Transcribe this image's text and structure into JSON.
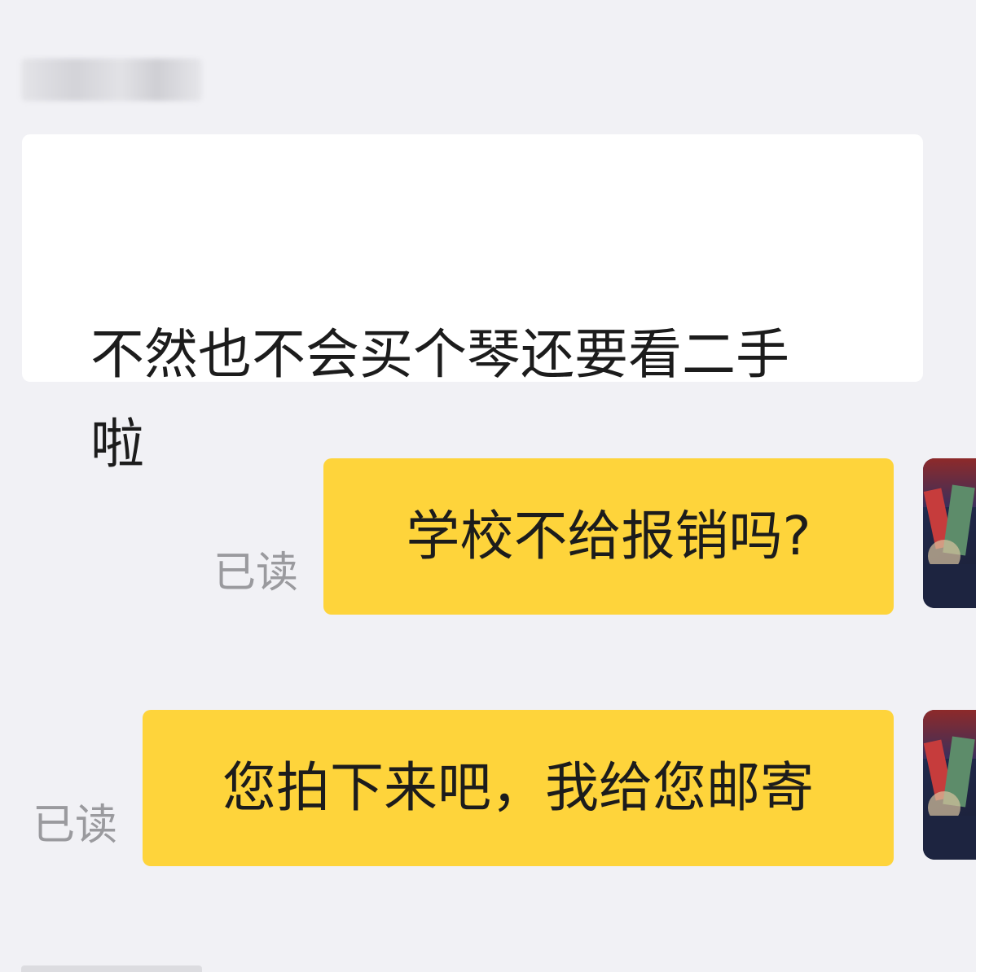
{
  "chat": {
    "messages": [
      {
        "direction": "incoming",
        "lines": [
          "不然也不会买个琴还要看二手",
          "啦"
        ]
      },
      {
        "direction": "outgoing",
        "text": "学校不给报销吗?",
        "read_status": "已读"
      },
      {
        "direction": "outgoing",
        "text": "您拍下来吧，我给您邮寄",
        "read_status": "已读"
      }
    ]
  },
  "colors": {
    "background": "#f1f1f5",
    "incoming_bubble": "#ffffff",
    "outgoing_bubble": "#fed43b",
    "read_status_text": "#9a9a9e"
  }
}
